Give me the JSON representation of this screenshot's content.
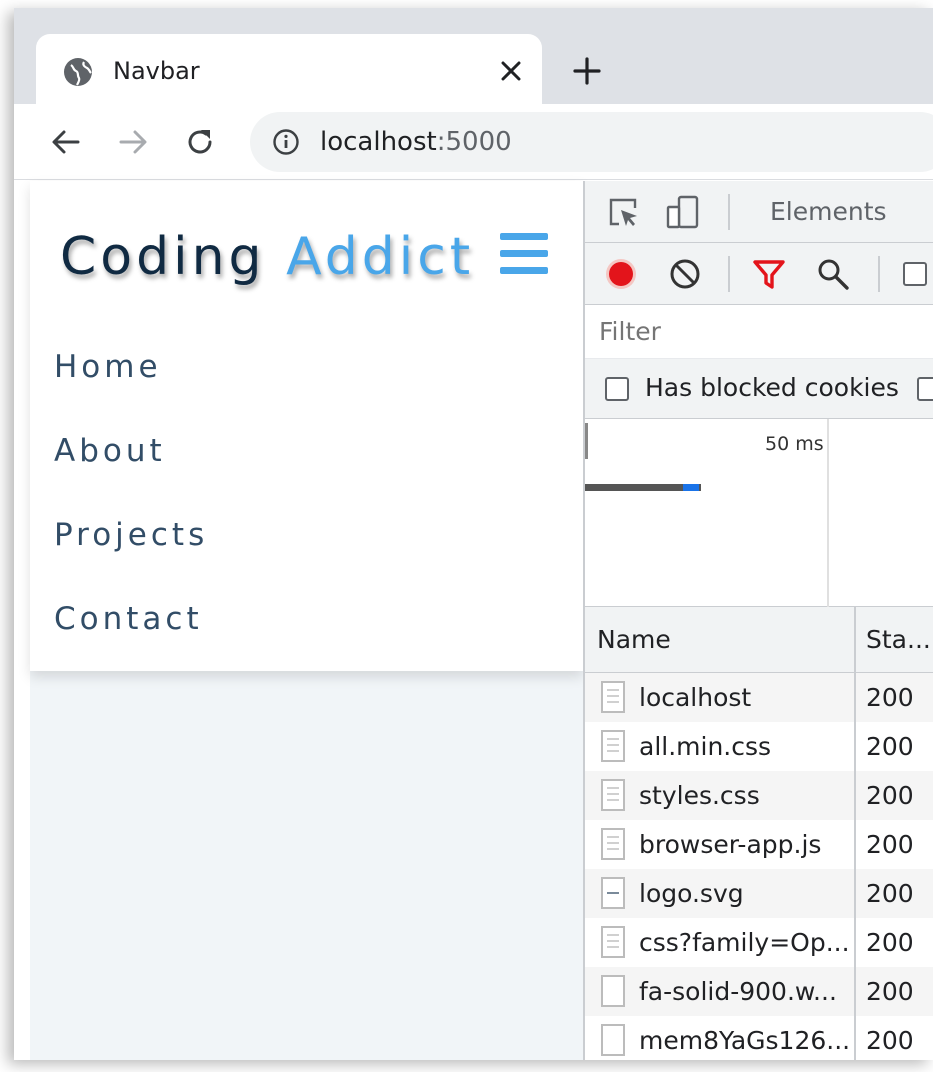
{
  "browser": {
    "tab_title": "Navbar",
    "url_host": "localhost",
    "url_port": ":5000"
  },
  "page": {
    "logo_part1": "Coding",
    "logo_part2": "Addict",
    "accent_color": "#49a6e9",
    "nav_links": [
      "Home",
      "About",
      "Projects",
      "Contact"
    ]
  },
  "devtools": {
    "panel_tab": "Elements",
    "filter_placeholder": "Filter",
    "has_blocked_cookies_label": "Has blocked cookies",
    "overview_tick": "50 ms",
    "columns": {
      "name": "Name",
      "status": "Sta..."
    },
    "requests": [
      {
        "name": "localhost",
        "status": "200",
        "icon": "document-icon"
      },
      {
        "name": "all.min.css",
        "status": "200",
        "icon": "document-icon"
      },
      {
        "name": "styles.css",
        "status": "200",
        "icon": "document-icon"
      },
      {
        "name": "browser-app.js",
        "status": "200",
        "icon": "document-icon"
      },
      {
        "name": "logo.svg",
        "status": "200",
        "icon": "image-icon"
      },
      {
        "name": "css?family=Op...",
        "status": "200",
        "icon": "document-icon"
      },
      {
        "name": "fa-solid-900.w...",
        "status": "200",
        "icon": "file-icon"
      },
      {
        "name": "mem8YaGs126...",
        "status": "200",
        "icon": "file-icon"
      }
    ]
  }
}
